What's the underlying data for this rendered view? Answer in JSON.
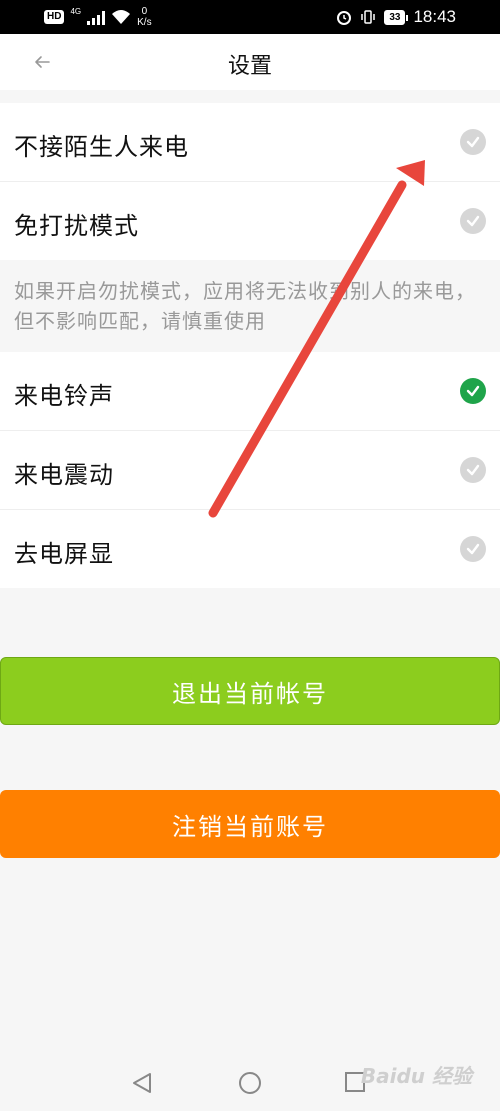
{
  "status_bar": {
    "hd": "HD",
    "network": "4G",
    "speed_value": "0",
    "speed_unit": "K/s",
    "battery": "33",
    "time": "18:43"
  },
  "header": {
    "title": "设置"
  },
  "group1": {
    "items": [
      {
        "label": "不接陌生人来电",
        "checked": false
      },
      {
        "label": "免打扰模式",
        "checked": false
      }
    ]
  },
  "note": "如果开启勿扰模式，应用将无法收到别人的来电，但不影响匹配，请慎重使用",
  "group2": {
    "items": [
      {
        "label": "来电铃声",
        "checked": true
      },
      {
        "label": "来电震动",
        "checked": false
      },
      {
        "label": "去电屏显",
        "checked": false
      }
    ]
  },
  "buttons": {
    "logout": "退出当前帐号",
    "cancel_account": "注销当前账号"
  },
  "watermark": "Baidu 经验",
  "colors": {
    "accent_green": "#1fa44a",
    "logout_button": "#8ccd1e",
    "cancel_button": "#ff8000",
    "annotation_arrow": "#e8463c"
  },
  "icons": {
    "back": "arrow-left-icon",
    "check": "check-circle-icon",
    "nav_back": "triangle-back-icon",
    "nav_home": "circle-home-icon",
    "nav_recent": "square-recent-icon"
  }
}
